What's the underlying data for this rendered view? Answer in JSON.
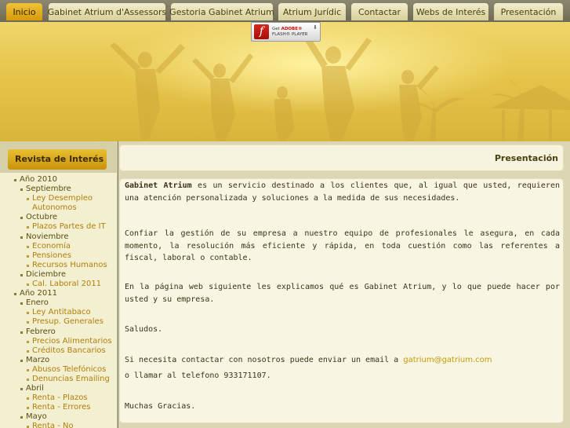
{
  "nav": {
    "tabs": [
      {
        "label": "Inicio",
        "active": true
      },
      {
        "label": "Gabinet Atrium d'Assessors",
        "active": false
      },
      {
        "label": "Gestoria Gabinet Atrium",
        "active": false
      },
      {
        "label": "Atrium Jurídic",
        "active": false
      },
      {
        "label": "Contactar",
        "active": false
      },
      {
        "label": "Webs de Interés",
        "active": false
      },
      {
        "label": "Presentación",
        "active": false
      }
    ]
  },
  "banner": {
    "flash": {
      "get": "Get",
      "adobe": "ADOBE®",
      "player": "FLASH® PLAYER",
      "logo": "f"
    }
  },
  "sidebar": {
    "header": "Revista de Interés",
    "tree": [
      {
        "level": 0,
        "text": "Año 2010"
      },
      {
        "level": 1,
        "text": "Septiembre"
      },
      {
        "level": 2,
        "text": "Ley Desempleo"
      },
      {
        "level": 3,
        "text": "Autonomos"
      },
      {
        "level": 1,
        "text": "Octubre"
      },
      {
        "level": 2,
        "text": "Plazos Partes de IT"
      },
      {
        "level": 1,
        "text": "Noviembre"
      },
      {
        "level": 2,
        "text": "Economía"
      },
      {
        "level": 2,
        "text": "Pensiones"
      },
      {
        "level": 2,
        "text": "Recursos Humanos"
      },
      {
        "level": 1,
        "text": "Diciembre"
      },
      {
        "level": 2,
        "text": "Cal. Laboral 2011"
      },
      {
        "level": 0,
        "text": "Año 2011"
      },
      {
        "level": 1,
        "text": "Enero"
      },
      {
        "level": 2,
        "text": "Ley Antitabaco"
      },
      {
        "level": 2,
        "text": "Presup. Generales"
      },
      {
        "level": 1,
        "text": "Febrero"
      },
      {
        "level": 2,
        "text": "Precios Alimentarios"
      },
      {
        "level": 2,
        "text": "Créditos Bancarios"
      },
      {
        "level": 1,
        "text": "Marzo"
      },
      {
        "level": 2,
        "text": "Abusos Telefónicos"
      },
      {
        "level": 2,
        "text": "Denuncias Emailing"
      },
      {
        "level": 1,
        "text": "Abril"
      },
      {
        "level": 2,
        "text": "Renta - Plazos"
      },
      {
        "level": 2,
        "text": "Renta - Errores"
      },
      {
        "level": 1,
        "text": "Mayo"
      },
      {
        "level": 2,
        "text": "Renta - No"
      }
    ]
  },
  "main": {
    "title": "Presentación",
    "p1_strong": "Gabinet Atrium",
    "p1_rest": " es un servicio destinado a los clientes que, al igual que usted, requieren una atención personalizada y soluciones a la medida de sus necesidades.",
    "p2": "Confiar la gestión de su empresa a nuestro equipo de profesionales le asegura, en cada momento, la resolución más eficiente y rápida, en toda cuestión como las referentes a fiscal, laboral o contable.",
    "p3": "En la página web siguiente les explicamos qué es Gabinet Atrium, y lo que puede hacer por usted y su empresa.",
    "p4": "Saludos.",
    "p5_text": "Si necesita contactar con nosotros puede enviar un email a ",
    "p5_email": "gatrium@gatrium.com",
    "p6": "o llamar al telefono 933171107.",
    "p7": "Muchas Gracias."
  },
  "colors": {
    "active_tab": "#e0a614",
    "link": "#c49a06",
    "banner": "#e6c44a"
  }
}
